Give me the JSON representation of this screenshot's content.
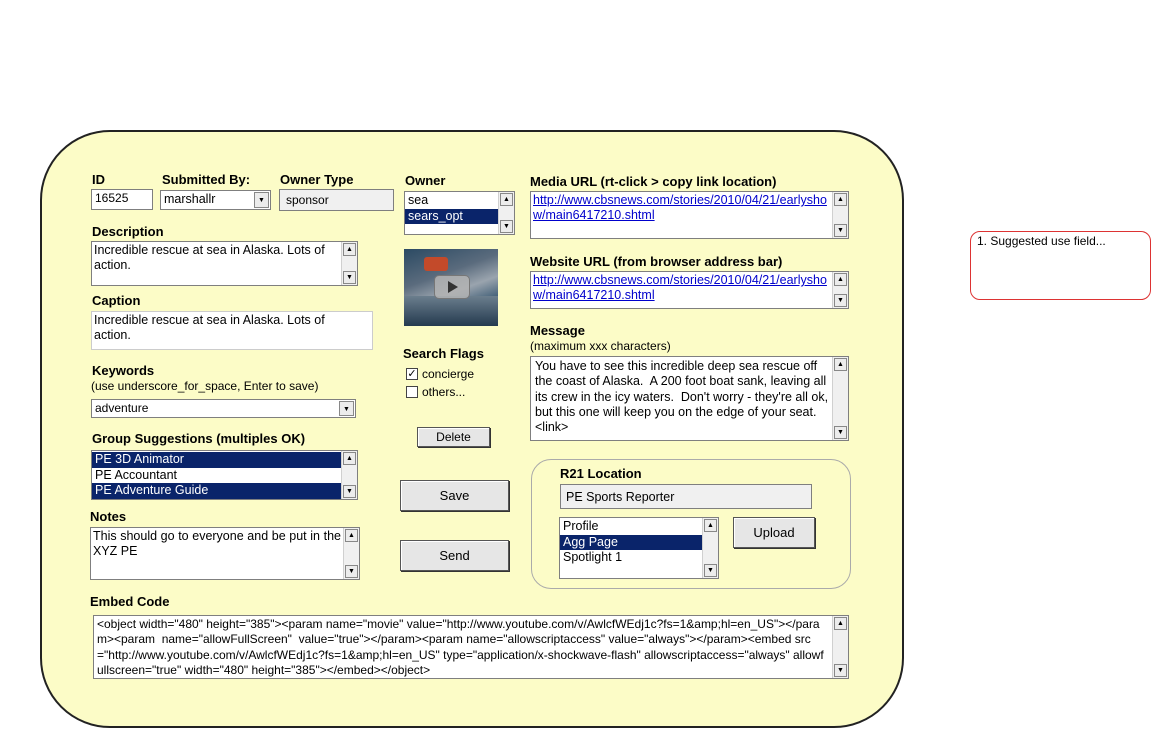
{
  "labels": {
    "id": "ID",
    "submitted_by": "Submitted By:",
    "owner_type": "Owner Type",
    "owner": "Owner",
    "media_url": "Media URL (rt-click > copy link location)",
    "website_url": "Website URL (from browser address bar)",
    "description": "Description",
    "caption": "Caption",
    "keywords": "Keywords",
    "keywords_hint": "(use underscore_for_space, Enter to save)",
    "group_suggestions": "Group Suggestions (multiples OK)",
    "notes": "Notes",
    "message": "Message",
    "message_hint": "(maximum xxx characters)",
    "search_flags": "Search Flags",
    "r21_location": "R21 Location",
    "embed_code": "Embed Code"
  },
  "fields": {
    "id": "16525",
    "submitted_by": "marshallr",
    "owner_type": "sponsor",
    "description": "Incredible rescue at sea in Alaska. Lots of action.",
    "caption": "Incredible rescue at sea in Alaska. Lots of action.",
    "keywords": "adventure",
    "media_url": "http://www.cbsnews.com/stories/2010/04/21/earlyshow/main6417210.shtml",
    "website_url": "http://www.cbsnews.com/stories/2010/04/21/earlyshow/main6417210.shtml",
    "message": "You have to see this incredible deep sea rescue off the coast of Alaska.  A 200 foot boat sank, leaving all its crew in the icy waters.  Don't worry - they're all ok, but this one will keep you on the edge of your seat. <link>",
    "notes": "This should go to everyone and be put in the XYZ PE",
    "r21_location": "PE Sports Reporter",
    "embed_code": "<object width=\"480\" height=\"385\"><param name=\"movie\" value=\"http://www.youtube.com/v/AwlcfWEdj1c?fs=1&amp;hl=en_US\"></param><param  name=\"allowFullScreen\"  value=\"true\"></param><param name=\"allowscriptaccess\" value=\"always\"></param><embed src=\"http://www.youtube.com/v/AwlcfWEdj1c?fs=1&amp;hl=en_US\" type=\"application/x-shockwave-flash\" allowscriptaccess=\"always\" allowfullscreen=\"true\" width=\"480\" height=\"385\"></embed></object>"
  },
  "owner_list": [
    {
      "label": "sea",
      "selected": false
    },
    {
      "label": "sears_opt",
      "selected": true
    }
  ],
  "group_list": [
    {
      "label": "PE  3D Animator",
      "selected": true
    },
    {
      "label": "PE  Accountant",
      "selected": false
    },
    {
      "label": "PE  Adventure Guide",
      "selected": true
    }
  ],
  "r21_list": [
    {
      "label": "Profile",
      "selected": false
    },
    {
      "label": "Agg Page",
      "selected": true
    },
    {
      "label": "Spotlight 1",
      "selected": false
    }
  ],
  "flags": [
    {
      "label": "concierge",
      "checked": true
    },
    {
      "label": "others...",
      "checked": false
    }
  ],
  "buttons": {
    "delete": "Delete",
    "save": "Save",
    "send": "Send",
    "upload": "Upload"
  },
  "side_note": "1. Suggested use field...",
  "colors": {
    "panel_bg": "#fcfcc7",
    "selection": "#0a246a",
    "note_border": "#dd3333"
  }
}
